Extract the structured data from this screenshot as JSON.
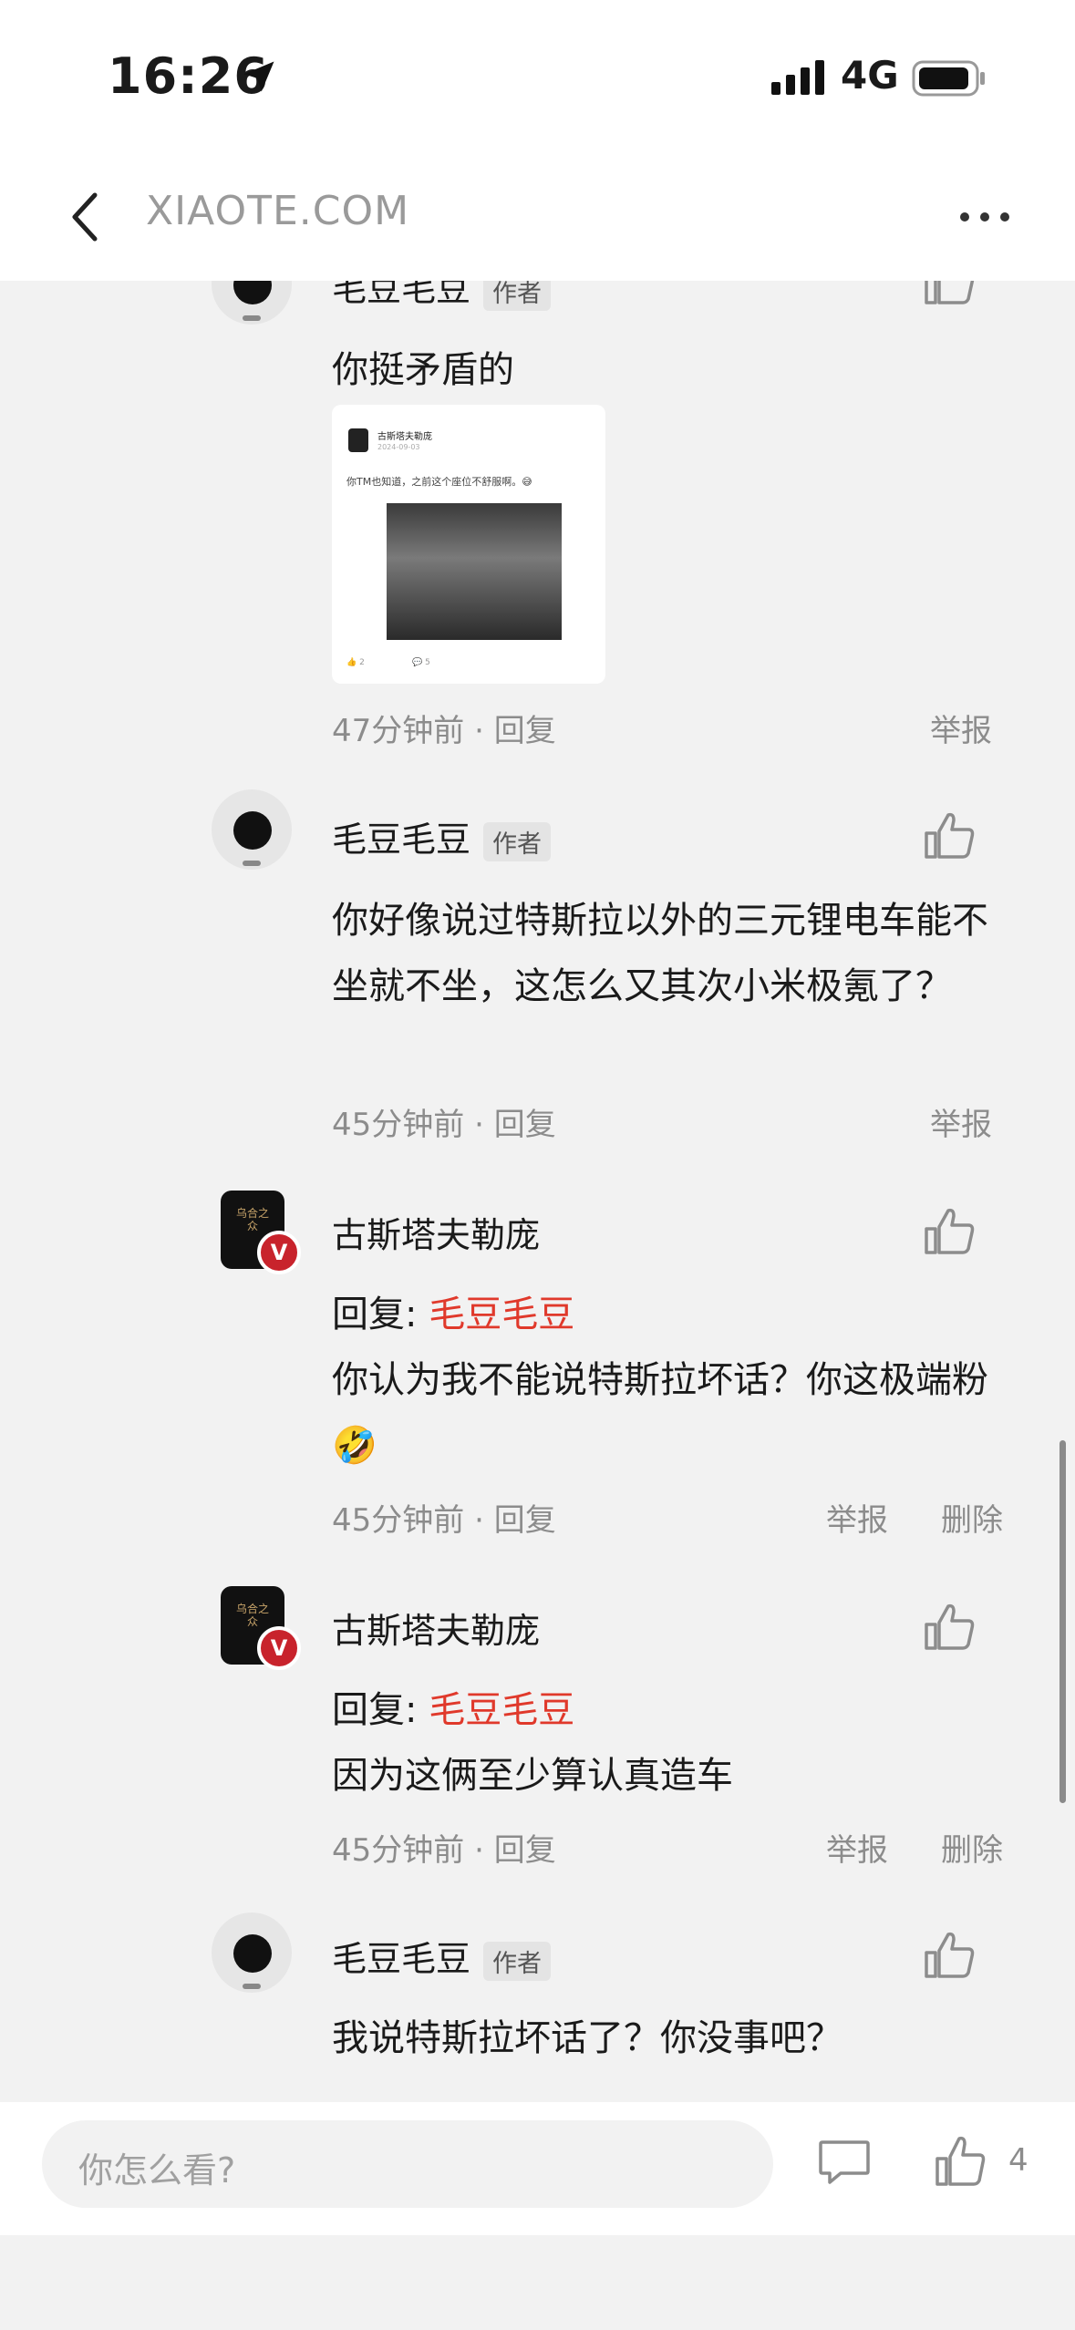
{
  "status": {
    "time": "16:26",
    "network": "4G"
  },
  "header": {
    "site": "XIAOTE.COM"
  },
  "comments": [
    {
      "user": "毛豆毛豆",
      "tag": "作者",
      "text": "你挺矛盾的",
      "embed": {
        "name": "古斯塔夫勒庞",
        "date": "2024-09-03",
        "text": "你TM也知道，之前这个座位不舒服啊。😅",
        "likes": "2",
        "comments": "5"
      },
      "time": "47分钟前",
      "reply": "回复",
      "report": "举报"
    },
    {
      "user": "毛豆毛豆",
      "tag": "作者",
      "text": "你好像说过特斯拉以外的三元锂电车能不坐就不坐，这怎么又其次小米极氪了？",
      "time": "45分钟前",
      "reply": "回复",
      "report": "举报"
    },
    {
      "user": "古斯塔夫勒庞",
      "badge": "V",
      "reply_prefix": "回复: ",
      "reply_to": "毛豆毛豆",
      "text": "你认为我不能说特斯拉坏话？你这极端粉🤣",
      "time": "45分钟前",
      "reply": "回复",
      "report": "举报",
      "delete": "删除"
    },
    {
      "user": "古斯塔夫勒庞",
      "badge": "V",
      "reply_prefix": "回复: ",
      "reply_to": "毛豆毛豆",
      "text": "因为这俩至少算认真造车",
      "time": "45分钟前",
      "reply": "回复",
      "report": "举报",
      "delete": "删除"
    },
    {
      "user": "毛豆毛豆",
      "tag": "作者",
      "text": "我说特斯拉坏话了？你没事吧？"
    }
  ],
  "bottom": {
    "placeholder": "你怎么看?",
    "like_count": "4"
  },
  "icons": [
    "back-arrow-icon",
    "more-dots-icon",
    "thumb-up-icon",
    "comment-bubble-icon",
    "location-arrow-icon",
    "signal-icon",
    "battery-icon"
  ],
  "colors": {
    "accent_red": "#e0392b",
    "vip_badge": "#c8232c",
    "muted_text": "#8c8c8c"
  }
}
